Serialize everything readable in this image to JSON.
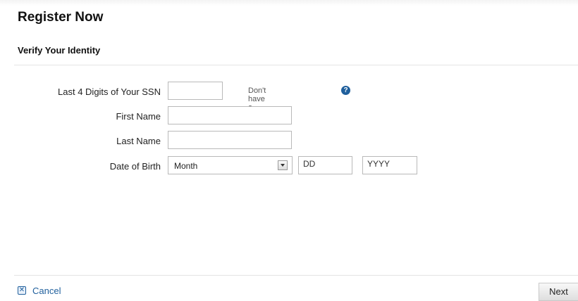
{
  "header": {
    "title": "Register Now",
    "section": "Verify Your Identity"
  },
  "form": {
    "ssn_label": "Last 4 Digits of Your SSN",
    "ssn_value": "",
    "no_ssn_text": "Don't have a SSN?",
    "help_icon": "question-circle-icon",
    "first_name_label": "First Name",
    "first_name_value": "",
    "last_name_label": "Last Name",
    "last_name_value": "",
    "dob_label": "Date of Birth",
    "dob_month_selected": "Month",
    "dob_day_placeholder": "DD",
    "dob_year_placeholder": "YYYY"
  },
  "footer": {
    "cancel_label": "Cancel",
    "cancel_icon": "close-box-icon",
    "next_label": "Next"
  },
  "colors": {
    "link_blue": "#1f5f9c",
    "border_gray": "#b9b9b9"
  }
}
